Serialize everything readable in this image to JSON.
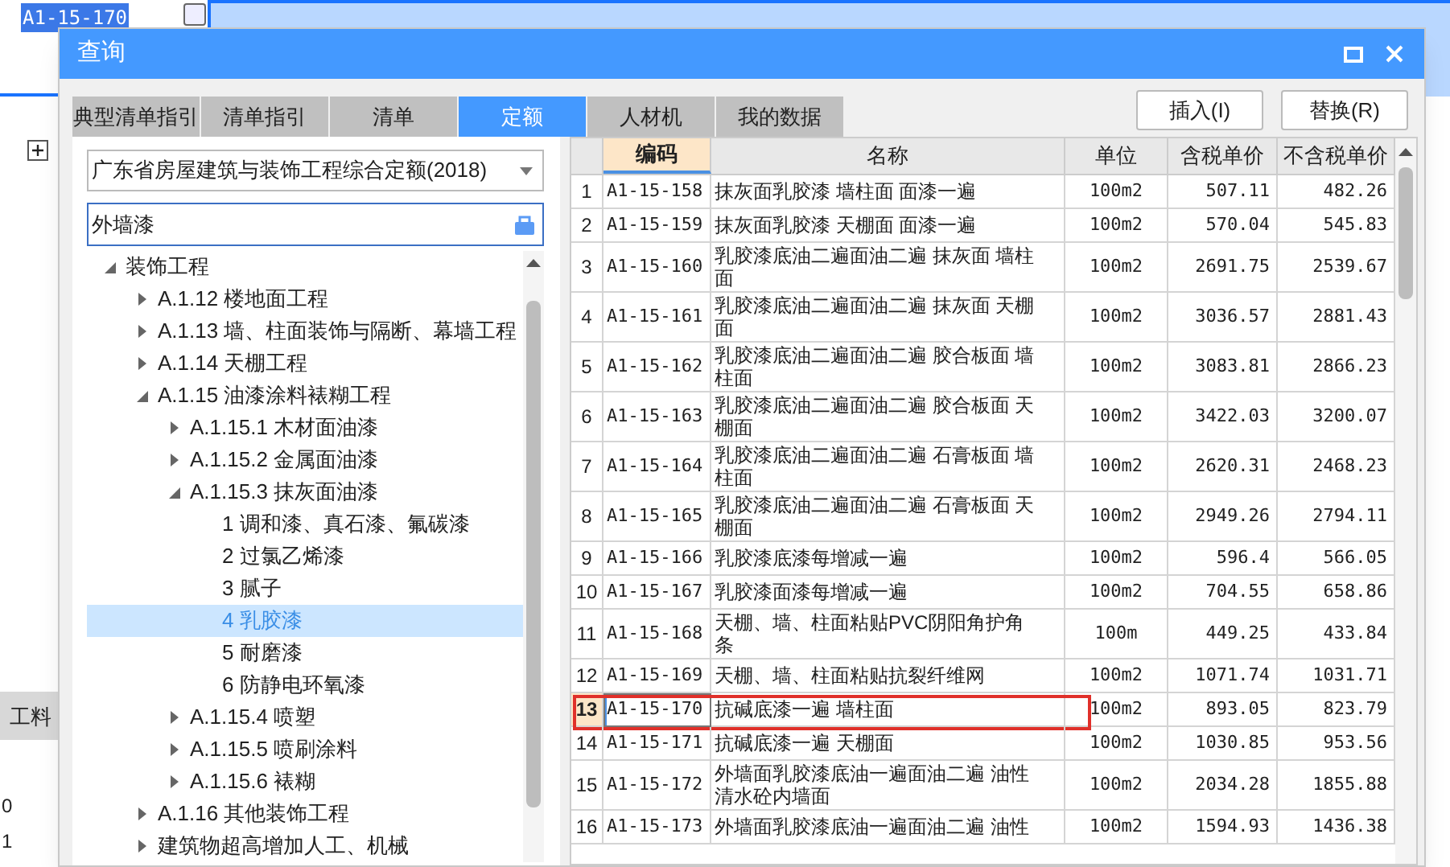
{
  "background": {
    "cell_code": "A1-15-170",
    "tab_label": "工料",
    "row_numbers": [
      "0",
      "1"
    ]
  },
  "dialog": {
    "title": "查询",
    "tabs": [
      {
        "label": "典型清单指引",
        "selected": false
      },
      {
        "label": "清单指引",
        "selected": false
      },
      {
        "label": "清单",
        "selected": false
      },
      {
        "label": "定额",
        "selected": true
      },
      {
        "label": "人材机",
        "selected": false
      },
      {
        "label": "我的数据",
        "selected": false
      }
    ],
    "buttons": [
      "插入(I)",
      "替换(R)"
    ],
    "library": "广东省房屋建筑与装饰工程综合定额(2018)",
    "search": "外墙漆",
    "tree": [
      {
        "label": "装饰工程",
        "expanded": true,
        "selected": false,
        "children": [
          {
            "label": "A.1.12 楼地面工程",
            "expanded": false,
            "selected": false
          },
          {
            "label": "A.1.13 墙、柱面装饰与隔断、幕墙工程",
            "expanded": false,
            "selected": false
          },
          {
            "label": "A.1.14 天棚工程",
            "expanded": false,
            "selected": false
          },
          {
            "label": "A.1.15 油漆涂料裱糊工程",
            "expanded": true,
            "selected": false,
            "children": [
              {
                "label": "A.1.15.1 木材面油漆",
                "expanded": false,
                "selected": false
              },
              {
                "label": "A.1.15.2 金属面油漆",
                "expanded": false,
                "selected": false
              },
              {
                "label": "A.1.15.3 抹灰面油漆",
                "expanded": true,
                "selected": false,
                "children": [
                  {
                    "label": "1 调和漆、真石漆、氟碳漆",
                    "selected": false
                  },
                  {
                    "label": "2 过氯乙烯漆",
                    "selected": false
                  },
                  {
                    "label": "3 腻子",
                    "selected": false
                  },
                  {
                    "label": "4 乳胶漆",
                    "selected": true
                  },
                  {
                    "label": "5 耐磨漆",
                    "selected": false
                  },
                  {
                    "label": "6 防静电环氧漆",
                    "selected": false
                  }
                ]
              },
              {
                "label": "A.1.15.4 喷塑",
                "expanded": false,
                "selected": false
              },
              {
                "label": "A.1.15.5 喷刷涂料",
                "expanded": false,
                "selected": false
              },
              {
                "label": "A.1.15.6 裱糊",
                "expanded": false,
                "selected": false
              }
            ]
          },
          {
            "label": "A.1.16 其他装饰工程",
            "expanded": false,
            "selected": false
          },
          {
            "label": "建筑物超高增加人工、机械",
            "expanded": false,
            "selected": false
          }
        ]
      }
    ],
    "table": {
      "columns": [
        "编码",
        "名称",
        "单位",
        "含税单价",
        "不含税单价"
      ],
      "rows": [
        {
          "num": "1",
          "code": "A1-15-158",
          "name": "抹灰面乳胶漆 墙柱面 面漆一遍",
          "unit": "100m2",
          "price_tax": "507.11",
          "price_notax": "482.26",
          "selected": false,
          "marked": false
        },
        {
          "num": "2",
          "code": "A1-15-159",
          "name": "抹灰面乳胶漆 天棚面 面漆一遍",
          "unit": "100m2",
          "price_tax": "570.04",
          "price_notax": "545.83",
          "selected": false,
          "marked": false
        },
        {
          "num": "3",
          "code": "A1-15-160",
          "name": "乳胶漆底油二遍面油二遍 抹灰面 墙柱面",
          "unit": "100m2",
          "price_tax": "2691.75",
          "price_notax": "2539.67",
          "selected": false,
          "marked": false
        },
        {
          "num": "4",
          "code": "A1-15-161",
          "name": "乳胶漆底油二遍面油二遍 抹灰面 天棚面",
          "unit": "100m2",
          "price_tax": "3036.57",
          "price_notax": "2881.43",
          "selected": false,
          "marked": false
        },
        {
          "num": "5",
          "code": "A1-15-162",
          "name": "乳胶漆底油二遍面油二遍 胶合板面 墙柱面",
          "unit": "100m2",
          "price_tax": "3083.81",
          "price_notax": "2866.23",
          "selected": false,
          "marked": false
        },
        {
          "num": "6",
          "code": "A1-15-163",
          "name": "乳胶漆底油二遍面油二遍 胶合板面 天棚面",
          "unit": "100m2",
          "price_tax": "3422.03",
          "price_notax": "3200.07",
          "selected": false,
          "marked": false
        },
        {
          "num": "7",
          "code": "A1-15-164",
          "name": "乳胶漆底油二遍面油二遍 石膏板面 墙柱面",
          "unit": "100m2",
          "price_tax": "2620.31",
          "price_notax": "2468.23",
          "selected": false,
          "marked": false
        },
        {
          "num": "8",
          "code": "A1-15-165",
          "name": "乳胶漆底油二遍面油二遍 石膏板面 天棚面",
          "unit": "100m2",
          "price_tax": "2949.26",
          "price_notax": "2794.11",
          "selected": false,
          "marked": false
        },
        {
          "num": "9",
          "code": "A1-15-166",
          "name": "乳胶漆底漆每增减一遍",
          "unit": "100m2",
          "price_tax": "596.4",
          "price_notax": "566.05",
          "selected": false,
          "marked": false
        },
        {
          "num": "10",
          "code": "A1-15-167",
          "name": "乳胶漆面漆每增减一遍",
          "unit": "100m2",
          "price_tax": "704.55",
          "price_notax": "658.86",
          "selected": false,
          "marked": false
        },
        {
          "num": "11",
          "code": "A1-15-168",
          "name": "天棚、墙、柱面粘贴PVC阴阳角护角条",
          "unit": "100m",
          "price_tax": "449.25",
          "price_notax": "433.84",
          "selected": false,
          "marked": false
        },
        {
          "num": "12",
          "code": "A1-15-169",
          "name": "天棚、墙、柱面粘贴抗裂纤维网",
          "unit": "100m2",
          "price_tax": "1071.74",
          "price_notax": "1031.71",
          "selected": false,
          "marked": false
        },
        {
          "num": "13",
          "code": "A1-15-170",
          "name": "抗碱底漆一遍 墙柱面",
          "unit": "100m2",
          "price_tax": "893.05",
          "price_notax": "823.79",
          "selected": true,
          "marked": true
        },
        {
          "num": "14",
          "code": "A1-15-171",
          "name": "抗碱底漆一遍 天棚面",
          "unit": "100m2",
          "price_tax": "1030.85",
          "price_notax": "953.56",
          "selected": false,
          "marked": false
        },
        {
          "num": "15",
          "code": "A1-15-172",
          "name": "外墙面乳胶漆底油一遍面油二遍 油性清水砼内墙面",
          "unit": "100m2",
          "price_tax": "2034.28",
          "price_notax": "1855.88",
          "selected": false,
          "marked": false
        },
        {
          "num": "16",
          "code": "A1-15-173",
          "name": "外墙面乳胶漆底油一遍面油二遍 油性",
          "unit": "100m2",
          "price_tax": "1594.93",
          "price_notax": "1436.38",
          "selected": false,
          "marked": false
        }
      ]
    }
  }
}
